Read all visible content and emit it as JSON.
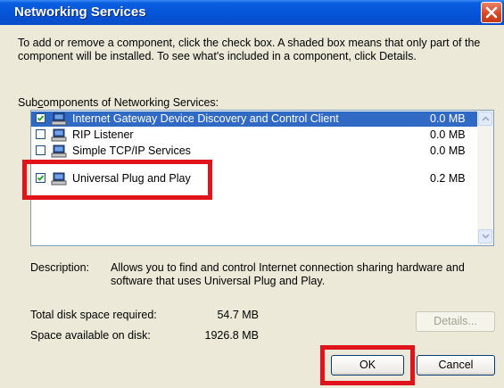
{
  "window": {
    "title": "Networking Services"
  },
  "intro_text": "To add or remove a component, click the check box. A shaded box means that only part of the component will be installed. To see what's included in a component, click Details.",
  "subcomponents_label": {
    "prefix": "Sub",
    "accel": "c",
    "rest": "omponents of Networking Services:"
  },
  "components": [
    {
      "name": "Internet Gateway Device Discovery and Control Client",
      "size": "0.0 MB",
      "checked": true,
      "selected": true
    },
    {
      "name": "RIP Listener",
      "size": "0.0 MB",
      "checked": false,
      "selected": false
    },
    {
      "name": "Simple TCP/IP Services",
      "size": "0.0 MB",
      "checked": false,
      "selected": false
    },
    {
      "name": "Universal Plug and Play",
      "size": "0.2 MB",
      "checked": true,
      "selected": false
    }
  ],
  "description": {
    "label": "Description:",
    "text": "Allows you to find and control Internet connection sharing hardware and software that uses Universal Plug and Play."
  },
  "disk": {
    "required_label": "Total disk space required:",
    "required_value": "54.7 MB",
    "available_label": "Space available on disk:",
    "available_value": "1926.8 MB"
  },
  "buttons": {
    "details": "Details...",
    "ok": "OK",
    "cancel": "Cancel"
  },
  "colors": {
    "titlebar": "#0554d8",
    "dialog_bg": "#ece9d8",
    "selection": "#316ac5",
    "highlight": "#e0141a"
  }
}
